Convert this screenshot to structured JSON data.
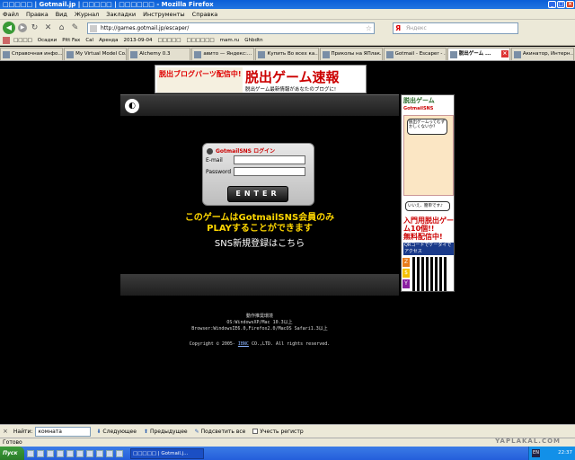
{
  "window": {
    "title": "□□□□□ | Gotmail.jp | □□□□□ | □□□□□□ - Mozilla Firefox"
  },
  "menu": [
    "Файл",
    "Правка",
    "Вид",
    "Журнал",
    "Закладки",
    "Инструменты",
    "Справка"
  ],
  "nav": {
    "url": "http://games.gotmail.jp/escaper/",
    "search_placeholder": "Яндекс"
  },
  "bookmarks": [
    "□□□□",
    "Осадки",
    "Pitt Fax",
    "Cal",
    "Аренда",
    "2013-09-04",
    "□□□□□",
    "□□□□□□",
    "mam.ru",
    "Ghbdtn"
  ],
  "tabs": [
    {
      "label": "Справочная инфо..."
    },
    {
      "label": "My Virtual Model Co..."
    },
    {
      "label": "Alchemy 0.3"
    },
    {
      "label": "авито — Яндекс:..."
    },
    {
      "label": "Купить Во всех ка..."
    },
    {
      "label": "Приколы на ЯПлак..."
    },
    {
      "label": "Gotmail - Escaper - ..."
    },
    {
      "label": "脱出ゲーム ..."
    },
    {
      "label": "Акинатор, Интерн..."
    }
  ],
  "banner": {
    "left_text": "脱出ブログパーツ配信中!",
    "main_text": "脱出ゲーム速報",
    "sub_text": "脱出ゲーム最新情報があなたのブログに!"
  },
  "login": {
    "header": "GotmailSNS ログイン",
    "email_label": "E-mail",
    "password_label": "Password",
    "enter_label": "ENTER"
  },
  "messages": {
    "line1": "このゲームはGotmailSNS会員のみ",
    "line2": "PLAYすることができます",
    "register": "SNS新規登録はこちら"
  },
  "footer": {
    "env_title": "動作推奨環境",
    "os": "OS:WindowsXP/Mac 10.3以上",
    "browser": "Browser:WindowsIE6.0,Firefox2.0/MacOS Safari1.3以上",
    "copyright_prefix": "Copyright © 2005- ",
    "company": "IBNC",
    "copyright_suffix": " CO.,LTD. All rights reserved."
  },
  "right_ad": {
    "title": "脱出ゲーム",
    "subtitle": "GotmailSNS",
    "bubble": "脱出ゲームってむずかしくないか?",
    "bubble2": "いいえ、簡単です♪",
    "big1": "入門用脱出ゲーム10個!!",
    "big2": "無料配信中!",
    "qr_label": "QRコードでケータイでアクセス"
  },
  "findbar": {
    "close": "×",
    "label": "Найти:",
    "value": "комната",
    "next": "Следующее",
    "prev": "Предыдущее",
    "highlight": "Подсветить все",
    "matchcase": "Учесть регистр"
  },
  "status": {
    "text": "Готово",
    "watermark": "YAPLAKAL.COM"
  },
  "taskbar": {
    "start": "Пуск",
    "task": "□□□□□ | Gotmail.j...",
    "lang": "EN",
    "clock": "22:37"
  }
}
